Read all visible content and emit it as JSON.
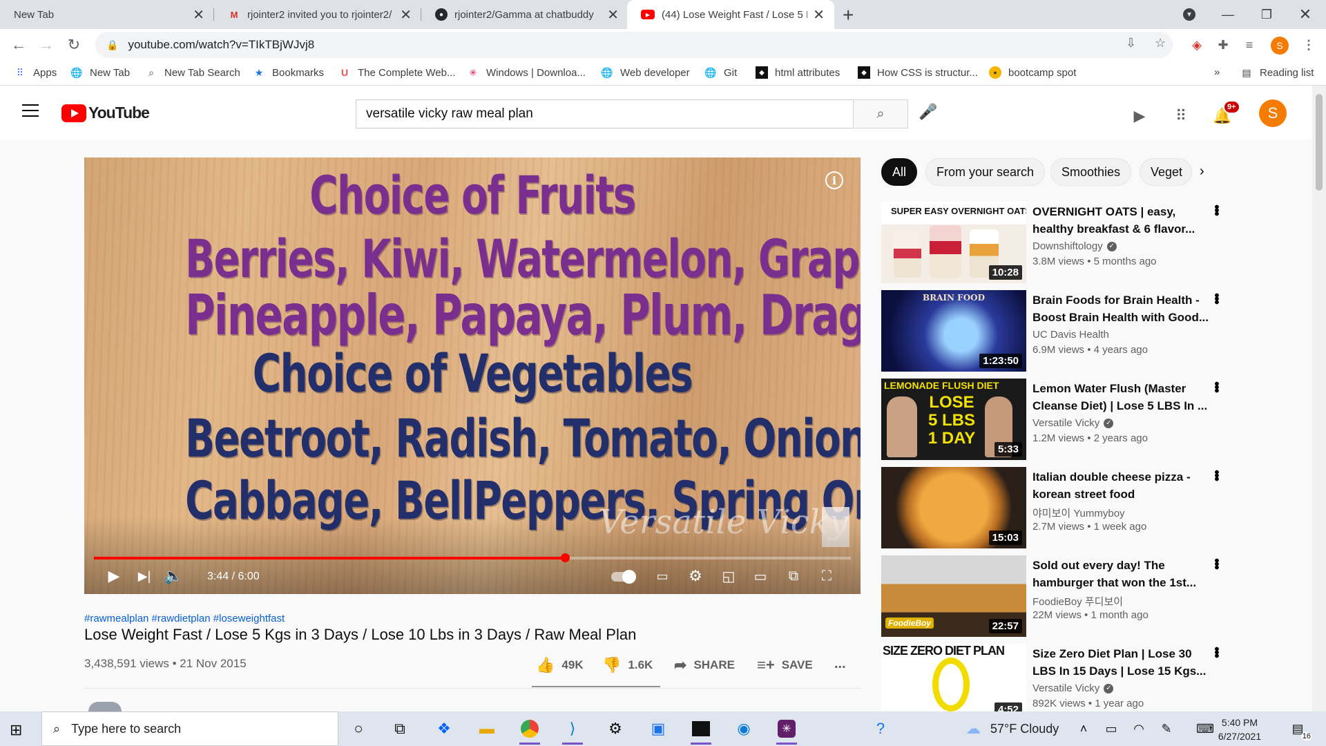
{
  "browser": {
    "tabs": [
      {
        "title": "New Tab",
        "active": false
      },
      {
        "title": "rjointer2 invited you to rjointer2/",
        "active": false
      },
      {
        "title": "rjointer2/Gamma at chatbuddy",
        "active": false
      },
      {
        "title": "(44) Lose Weight Fast / Lose 5 Kg",
        "active": true
      }
    ],
    "url": "youtube.com/watch?v=TIkTBjWJvj8",
    "bookmarks": [
      {
        "label": "Apps",
        "icon": "apps-grid-icon"
      },
      {
        "label": "New Tab",
        "icon": "globe-icon"
      },
      {
        "label": "New Tab Search",
        "icon": "search-icon"
      },
      {
        "label": "Bookmarks",
        "icon": "star-icon"
      },
      {
        "label": "The Complete Web...",
        "icon": "udemy-icon"
      },
      {
        "label": "Windows | Downloa...",
        "icon": "slack-icon"
      },
      {
        "label": "Web developer",
        "icon": "globe-icon"
      },
      {
        "label": "Git",
        "icon": "globe-icon"
      },
      {
        "label": "html attributes",
        "icon": "page-icon"
      },
      {
        "label": "How CSS is structur...",
        "icon": "page-icon"
      },
      {
        "label": "bootcamp spot",
        "icon": "bootcamp-icon"
      }
    ],
    "bookmarks_overflow": "»",
    "reading_list": "Reading list",
    "profile_initial": "S"
  },
  "youtube": {
    "logo_text": "YouTube",
    "search_value": "versatile vicky raw meal plan",
    "notification_count": "9+",
    "avatar_initial": "S",
    "player": {
      "lines": [
        "Choice of Fruits",
        "Berries, Kiwi, Watermelon, Grapes",
        "Pineapple, Papaya, Plum, Dragon Fruit",
        "Choice of Vegetables",
        "Beetroot, Radish, Tomato, Onion",
        "Cabbage, BellPeppers, Spring Onion"
      ],
      "watermark": "Versatile Vicky",
      "time": "3:44 / 6:00",
      "progress_fraction": 0.622
    },
    "video": {
      "hashtags": "#rawmealplan #rawdietplan #loseweightfast",
      "title": "Lose Weight Fast / Lose 5 Kgs in 3 Days / Lose 10 Lbs in 3 Days / Raw Meal Plan",
      "views_date": "3,438,591 views • 21 Nov 2015",
      "likes": "49K",
      "dislikes": "1.6K",
      "share": "SHARE",
      "save": "SAVE",
      "more": "..."
    },
    "chips": [
      "All",
      "From your search",
      "Smoothies",
      "Veget"
    ],
    "recommendations": [
      {
        "title": "OVERNIGHT OATS | easy, healthy breakfast & 6 flavor...",
        "channel": "Downshiftology",
        "verified": true,
        "meta": "3.8M views • 5 months ago",
        "duration": "10:28",
        "thumb_text": "SUPER EASY OVERNIGHT OATS"
      },
      {
        "title": "Brain Foods for Brain Health - Boost Brain Health with Good...",
        "channel": "UC Davis Health",
        "verified": false,
        "meta": "6.9M views • 4 years ago",
        "duration": "1:23:50",
        "thumb_text": "BRAIN FOOD"
      },
      {
        "title": "Lemon Water Flush (Master Cleanse Diet) | Lose 5 LBS In ...",
        "channel": "Versatile Vicky",
        "verified": true,
        "meta": "1.2M views • 2 years ago",
        "duration": "5:33",
        "thumb_text": "LEMONADE FLUSH DIET"
      },
      {
        "title": "Italian double cheese pizza - korean street food",
        "channel": "야미보이 Yummyboy",
        "verified": false,
        "meta": "2.7M views • 1 week ago",
        "duration": "15:03",
        "thumb_text": ""
      },
      {
        "title": "Sold out every day! The hamburger that won the 1st...",
        "channel": "FoodieBoy 푸디보이",
        "verified": false,
        "meta": "22M views • 1 month ago",
        "duration": "22:57",
        "thumb_text": "FoodieBoy"
      },
      {
        "title": "Size Zero Diet Plan | Lose 30 LBS In 15 Days | Lose 15 Kgs...",
        "channel": "Versatile Vicky",
        "verified": true,
        "meta": "892K views • 1 year ago",
        "duration": "4:52",
        "thumb_text": "SIZE ZERO DIET PLAN"
      }
    ]
  },
  "taskbar": {
    "search_placeholder": "Type here to search",
    "weather": "57°F  Cloudy",
    "time": "5:40 PM",
    "date": "6/27/2021",
    "notification_count": "16"
  },
  "colors": {
    "youtube_red": "#ff0000",
    "link_blue": "#065fd4",
    "fruit_text": "#7a2f8e",
    "veg_text": "#232f6b",
    "avatar_orange": "#f57c00"
  }
}
